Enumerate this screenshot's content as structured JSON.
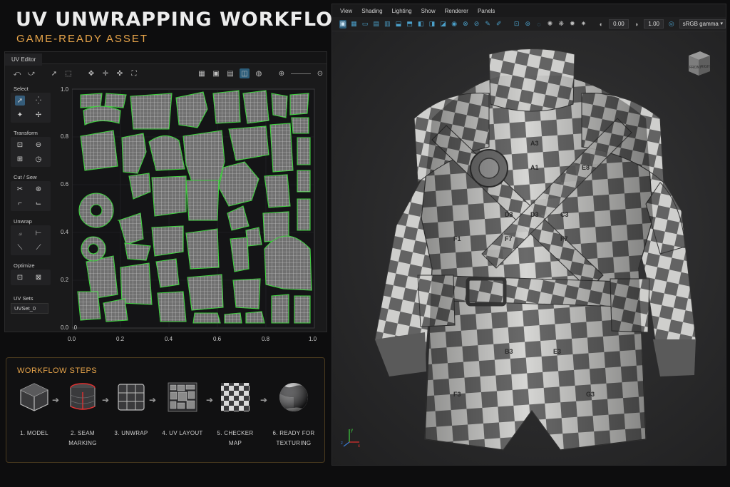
{
  "header": {
    "title": "UV UNWRAPPING WORKFLOW",
    "subtitle": "GAME-READY ASSET"
  },
  "uv_editor": {
    "tab": "UV Editor",
    "sections": {
      "select": "Select",
      "transform": "Transform",
      "cut_sew": "Cut / Sew",
      "unwrap": "Unwrap",
      "optimize": "Optimize",
      "uv_sets": "UV Sets"
    },
    "uv_set_value": "UVSet_0",
    "x_ticks": [
      "0.0",
      "0.2",
      "0.4",
      "0.6",
      "0.8",
      "1.0"
    ],
    "y_ticks": [
      "1.0",
      "0.8",
      "0.6",
      "0.4",
      "0.2",
      "0.0"
    ]
  },
  "workflow": {
    "title": "WORKFLOW STEPS",
    "steps": [
      {
        "line1": "1. MODEL",
        "line2": ""
      },
      {
        "line1": "2. SEAM",
        "line2": "MARKING"
      },
      {
        "line1": "3. UNWRAP",
        "line2": ""
      },
      {
        "line1": "4. UV LAYOUT",
        "line2": ""
      },
      {
        "line1": "5. CHECKER",
        "line2": "MAP"
      },
      {
        "line1": "6. READY FOR",
        "line2": "TEXTURING"
      }
    ]
  },
  "viewport": {
    "menu": [
      "View",
      "Shading",
      "Lighting",
      "Show",
      "Renderer",
      "Panels"
    ],
    "exposure": "0.00",
    "gamma": "1.00",
    "color_space": "sRGB gamma",
    "viewcube": {
      "front": "FRONT",
      "right": "RIGHT"
    },
    "axes": {
      "x": "x",
      "y": "y",
      "z": "z"
    }
  },
  "checker_labels": [
    "A3",
    "D3",
    "F1",
    "F7",
    "B3",
    "E3",
    "F3",
    "R2",
    "C3",
    "A1",
    "E8",
    "D3",
    "F7",
    "G3"
  ],
  "colors": {
    "accent": "#e8a54a",
    "uv_seam": "#3fd13f",
    "selection": "#2c5d7a",
    "icon_blue": "#4a9fc9"
  }
}
